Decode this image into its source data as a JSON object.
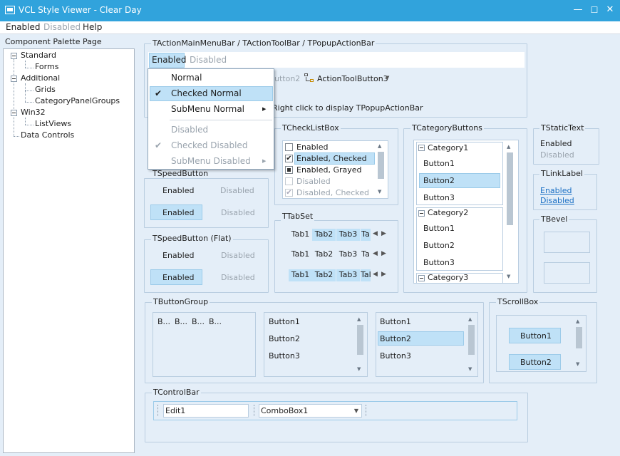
{
  "window": {
    "title": "VCL Style Viewer - Clear Day",
    "minimize": "—",
    "maximize": "☐",
    "close": "✕"
  },
  "menubar": {
    "enabled": "Enabled",
    "disabled": "Disabled",
    "help": "Help"
  },
  "palette": {
    "caption": "Component Palette Page",
    "standard": "Standard",
    "forms": "Forms",
    "additional": "Additional",
    "grids": "Grids",
    "catpanel": "CategoryPanelGroups",
    "win32": "Win32",
    "listviews": "ListViews",
    "datacontrols": "Data Controls"
  },
  "actionbar": {
    "caption": "TActionMainMenuBar / TActionToolBar / TPopupActionBar",
    "menu_enabled": "Enabled",
    "menu_disabled": "Disabled",
    "tool2": "utton2",
    "tool3": "ActionToolButton3",
    "hint": "Right click to display TPopupActionBar"
  },
  "popup": {
    "normal": "Normal",
    "checked_normal": "Checked Normal",
    "submenu_normal": "SubMenu Normal",
    "disabled": "Disabled",
    "checked_disabled": "Checked Disabled",
    "submenu_disabled": "SubMenu Disabled",
    "check": "✔",
    "arrow": "▶"
  },
  "speed": {
    "caption": "TSpeedButton",
    "enabled1": "Enabled",
    "disabled1": "Disabled",
    "enabled2": "Enabled",
    "disabled2": "Disabled"
  },
  "speedflat": {
    "caption": "TSpeedButton (Flat)",
    "enabled1": "Enabled",
    "disabled1": "Disabled",
    "enabled2": "Enabled",
    "disabled2": "Disabled"
  },
  "checklist": {
    "caption": "TCheckListBox",
    "items": [
      "Enabled",
      "Enabled, Checked",
      "Enabled, Grayed",
      "Disabled",
      "Disabled, Checked"
    ]
  },
  "tabset": {
    "caption": "TTabSet",
    "tabs": [
      "Tab1",
      "Tab2",
      "Tab3",
      "Ta"
    ],
    "tabs3": [
      "Tab1",
      "Tab2",
      "Tab3",
      "Tal"
    ]
  },
  "category": {
    "caption": "TCategoryButtons",
    "cat1": "Category1",
    "cat2": "Category2",
    "cat3": "Category3",
    "b1": "Button1",
    "b2": "Button2",
    "b3": "Button3"
  },
  "statictext": {
    "caption": "TStaticText",
    "enabled": "Enabled",
    "disabled": "Disabled"
  },
  "linklabel": {
    "caption": "TLinkLabel",
    "enabled": "Enabled",
    "disabled": "Disabled"
  },
  "bevel": {
    "caption": "TBevel"
  },
  "buttongroup": {
    "caption": "TButtonGroup",
    "short": [
      "B...",
      "B...",
      "B...",
      "B..."
    ],
    "b1": "Button1",
    "b2": "Button2",
    "b3": "Button3"
  },
  "scrollbox": {
    "caption": "TScrollBox",
    "b1": "Button1",
    "b2": "Button2"
  },
  "controlbar": {
    "caption": "TControlBar",
    "edit": "Edit1",
    "combo": "ComboBox1"
  },
  "colors": {
    "accent": "#31a3dc",
    "selection": "#bfe1f7",
    "background": "#e4eef8"
  }
}
